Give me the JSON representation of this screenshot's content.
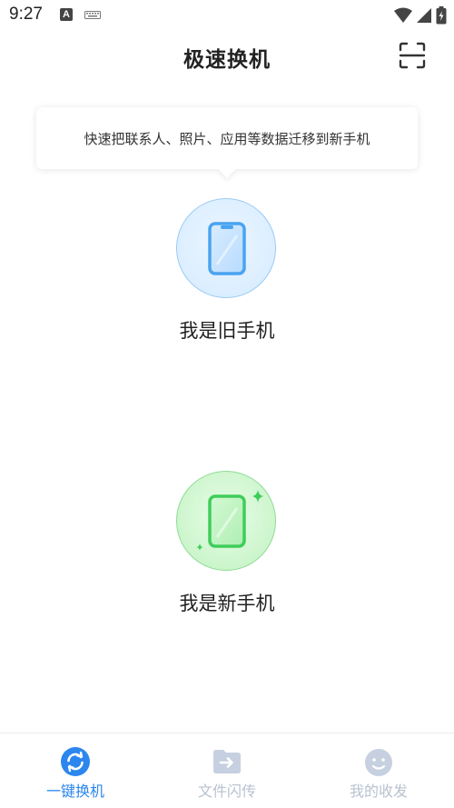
{
  "status_bar": {
    "time": "9:27",
    "notification_letter": "A"
  },
  "header": {
    "title": "极速换机",
    "scan_icon": "scan-icon"
  },
  "tip": {
    "text": "快速把联系人、照片、应用等数据迁移到新手机"
  },
  "options": {
    "old_phone": {
      "label": "我是旧手机",
      "icon": "phone-icon",
      "color": "#4aa3f0"
    },
    "new_phone": {
      "label": "我是新手机",
      "icon": "phone-sparkle-icon",
      "color": "#3fcd5a"
    }
  },
  "bottom_nav": {
    "items": [
      {
        "label": "一键换机",
        "icon": "refresh-icon",
        "active": true
      },
      {
        "label": "文件闪传",
        "icon": "folder-transfer-icon",
        "active": false
      },
      {
        "label": "我的收发",
        "icon": "smiley-icon",
        "active": false
      }
    ]
  },
  "colors": {
    "accent": "#2b86ee",
    "inactive": "#b8c2d0"
  }
}
